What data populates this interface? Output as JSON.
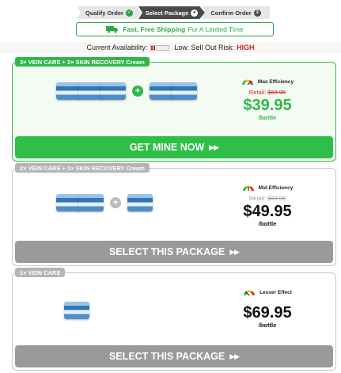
{
  "steps": [
    {
      "label": "Qualify Order",
      "icon": "check-icon"
    },
    {
      "label": "Select Package",
      "icon": "current-dot-icon"
    },
    {
      "label": "Confirm Order",
      "icon": "step-number-icon",
      "number": "3"
    }
  ],
  "shipping": {
    "icon": "truck-icon",
    "bold": "Fast, Free Shipping",
    "rest": "For A Limited Time"
  },
  "availability": {
    "label": "Current Availability:",
    "text": "Low. Sell Out Risk:",
    "risk": "HIGH",
    "level_fraction": 0.2
  },
  "packages": [
    {
      "tag": "3× VEIN CARE + 2× SKIN RECOVERY Cream",
      "efficiency": "Max Efficiency",
      "retail_label": "Retail:",
      "retail_price": "$69.95",
      "price": "$39.95",
      "per": "/bottle",
      "button": "GET MINE NOW",
      "button_icon": "double-chevron-right-icon"
    },
    {
      "tag": "2× VEIN CARE + 1× SKIN RECOVERY Cream",
      "efficiency": "Mid Efficiency",
      "retail_label": "Retail:",
      "retail_price": "$69.95",
      "price": "$49.95",
      "per": "/bottle",
      "button": "SELECT THIS PACKAGE",
      "button_icon": "double-chevron-right-icon"
    },
    {
      "tag": "1× VEIN CARE",
      "efficiency": "Lesser Effect",
      "price": "$69.95",
      "per": "/bottle",
      "button": "SELECT THIS PACKAGE",
      "button_icon": "double-chevron-right-icon"
    }
  ],
  "colors": {
    "accent": "#2fb84a",
    "risk": "#d92121",
    "inactive_button": "#9a9a9a",
    "active_step": "#4a4a4a"
  }
}
